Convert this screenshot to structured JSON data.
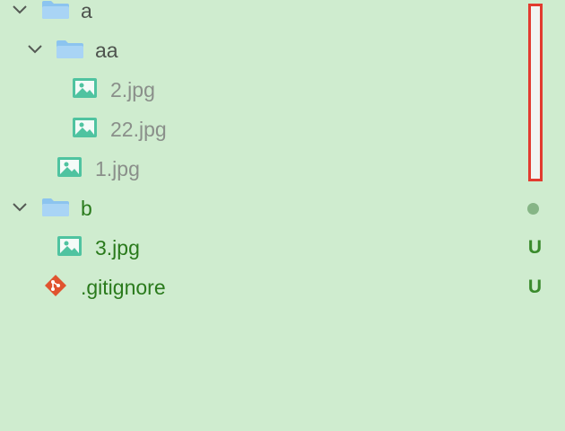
{
  "tree": {
    "folder_a": {
      "label": "a",
      "icon": "folder-icon",
      "expanded": true
    },
    "folder_aa": {
      "label": "aa",
      "icon": "folder-icon",
      "expanded": true
    },
    "file_2jpg": {
      "label": "2.jpg",
      "icon": "image-icon"
    },
    "file_22jpg": {
      "label": "22.jpg",
      "icon": "image-icon"
    },
    "file_1jpg": {
      "label": "1.jpg",
      "icon": "image-icon"
    },
    "folder_b": {
      "label": "b",
      "icon": "folder-icon",
      "expanded": true,
      "status": "modified-dot"
    },
    "file_3jpg": {
      "label": "3.jpg",
      "icon": "image-icon",
      "status": "U"
    },
    "file_gitignore": {
      "label": ".gitignore",
      "icon": "git-icon",
      "status": "U"
    }
  },
  "colors": {
    "background": "#cfeccf",
    "ignored_text": "#8a8f8a",
    "untracked_text": "#2a7a1c",
    "status_letter": "#3a8a2c",
    "folder_blue": "#8cc4ef",
    "image_teal": "#4fc3a0",
    "git_red": "#e0532f",
    "highlight_red": "#e23b2f"
  }
}
